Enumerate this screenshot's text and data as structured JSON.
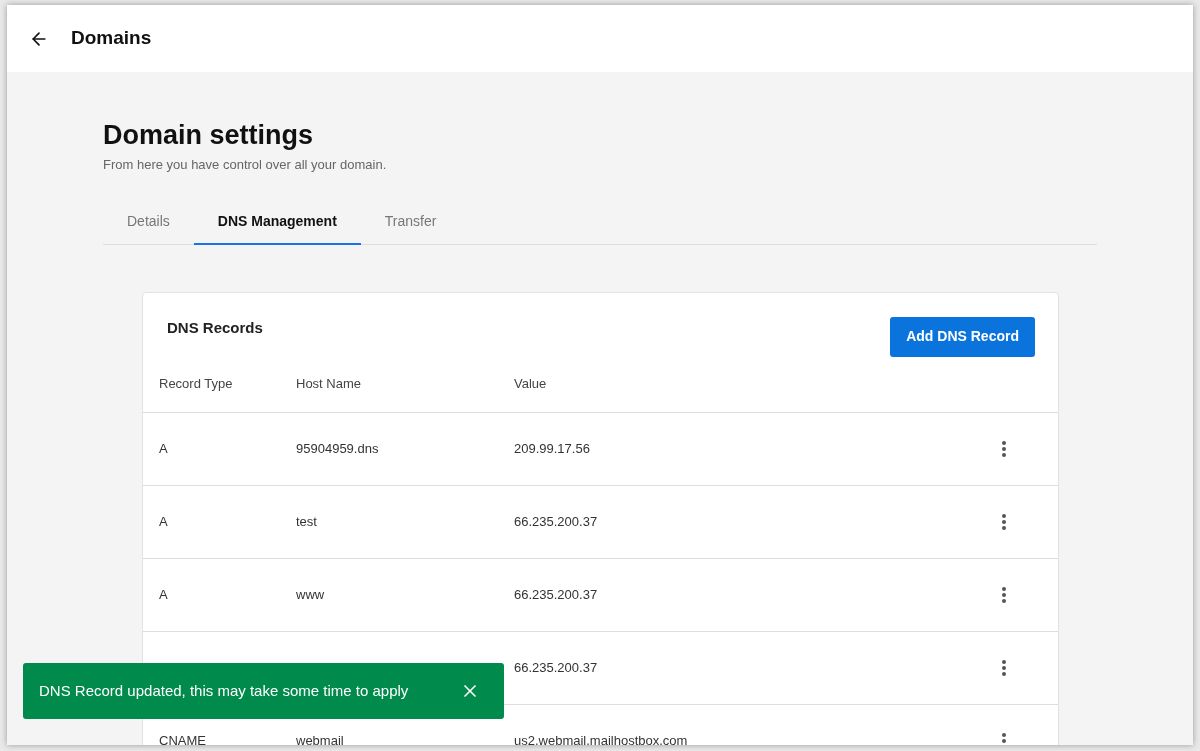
{
  "header": {
    "title": "Domains"
  },
  "page": {
    "title": "Domain settings",
    "subtitle": "From here you have control over all your domain."
  },
  "tabs": [
    {
      "label": "Details",
      "selected": false
    },
    {
      "label": "DNS Management",
      "selected": true
    },
    {
      "label": "Transfer",
      "selected": false
    }
  ],
  "card": {
    "title": "DNS Records",
    "add_button": "Add DNS Record",
    "columns": [
      "Record Type",
      "Host Name",
      "Value"
    ],
    "rows": [
      {
        "type": "A",
        "host": "95904959.dns",
        "value": "209.99.17.56"
      },
      {
        "type": "A",
        "host": "test",
        "value": "66.235.200.37"
      },
      {
        "type": "A",
        "host": "www",
        "value": "66.235.200.37"
      },
      {
        "value": "66.235.200.37"
      },
      {
        "type": "CNAME",
        "host": "webmail",
        "value": "us2.webmail.mailhostbox.com"
      }
    ]
  },
  "toast": {
    "message": "DNS Record updated, this may take some time to apply"
  }
}
